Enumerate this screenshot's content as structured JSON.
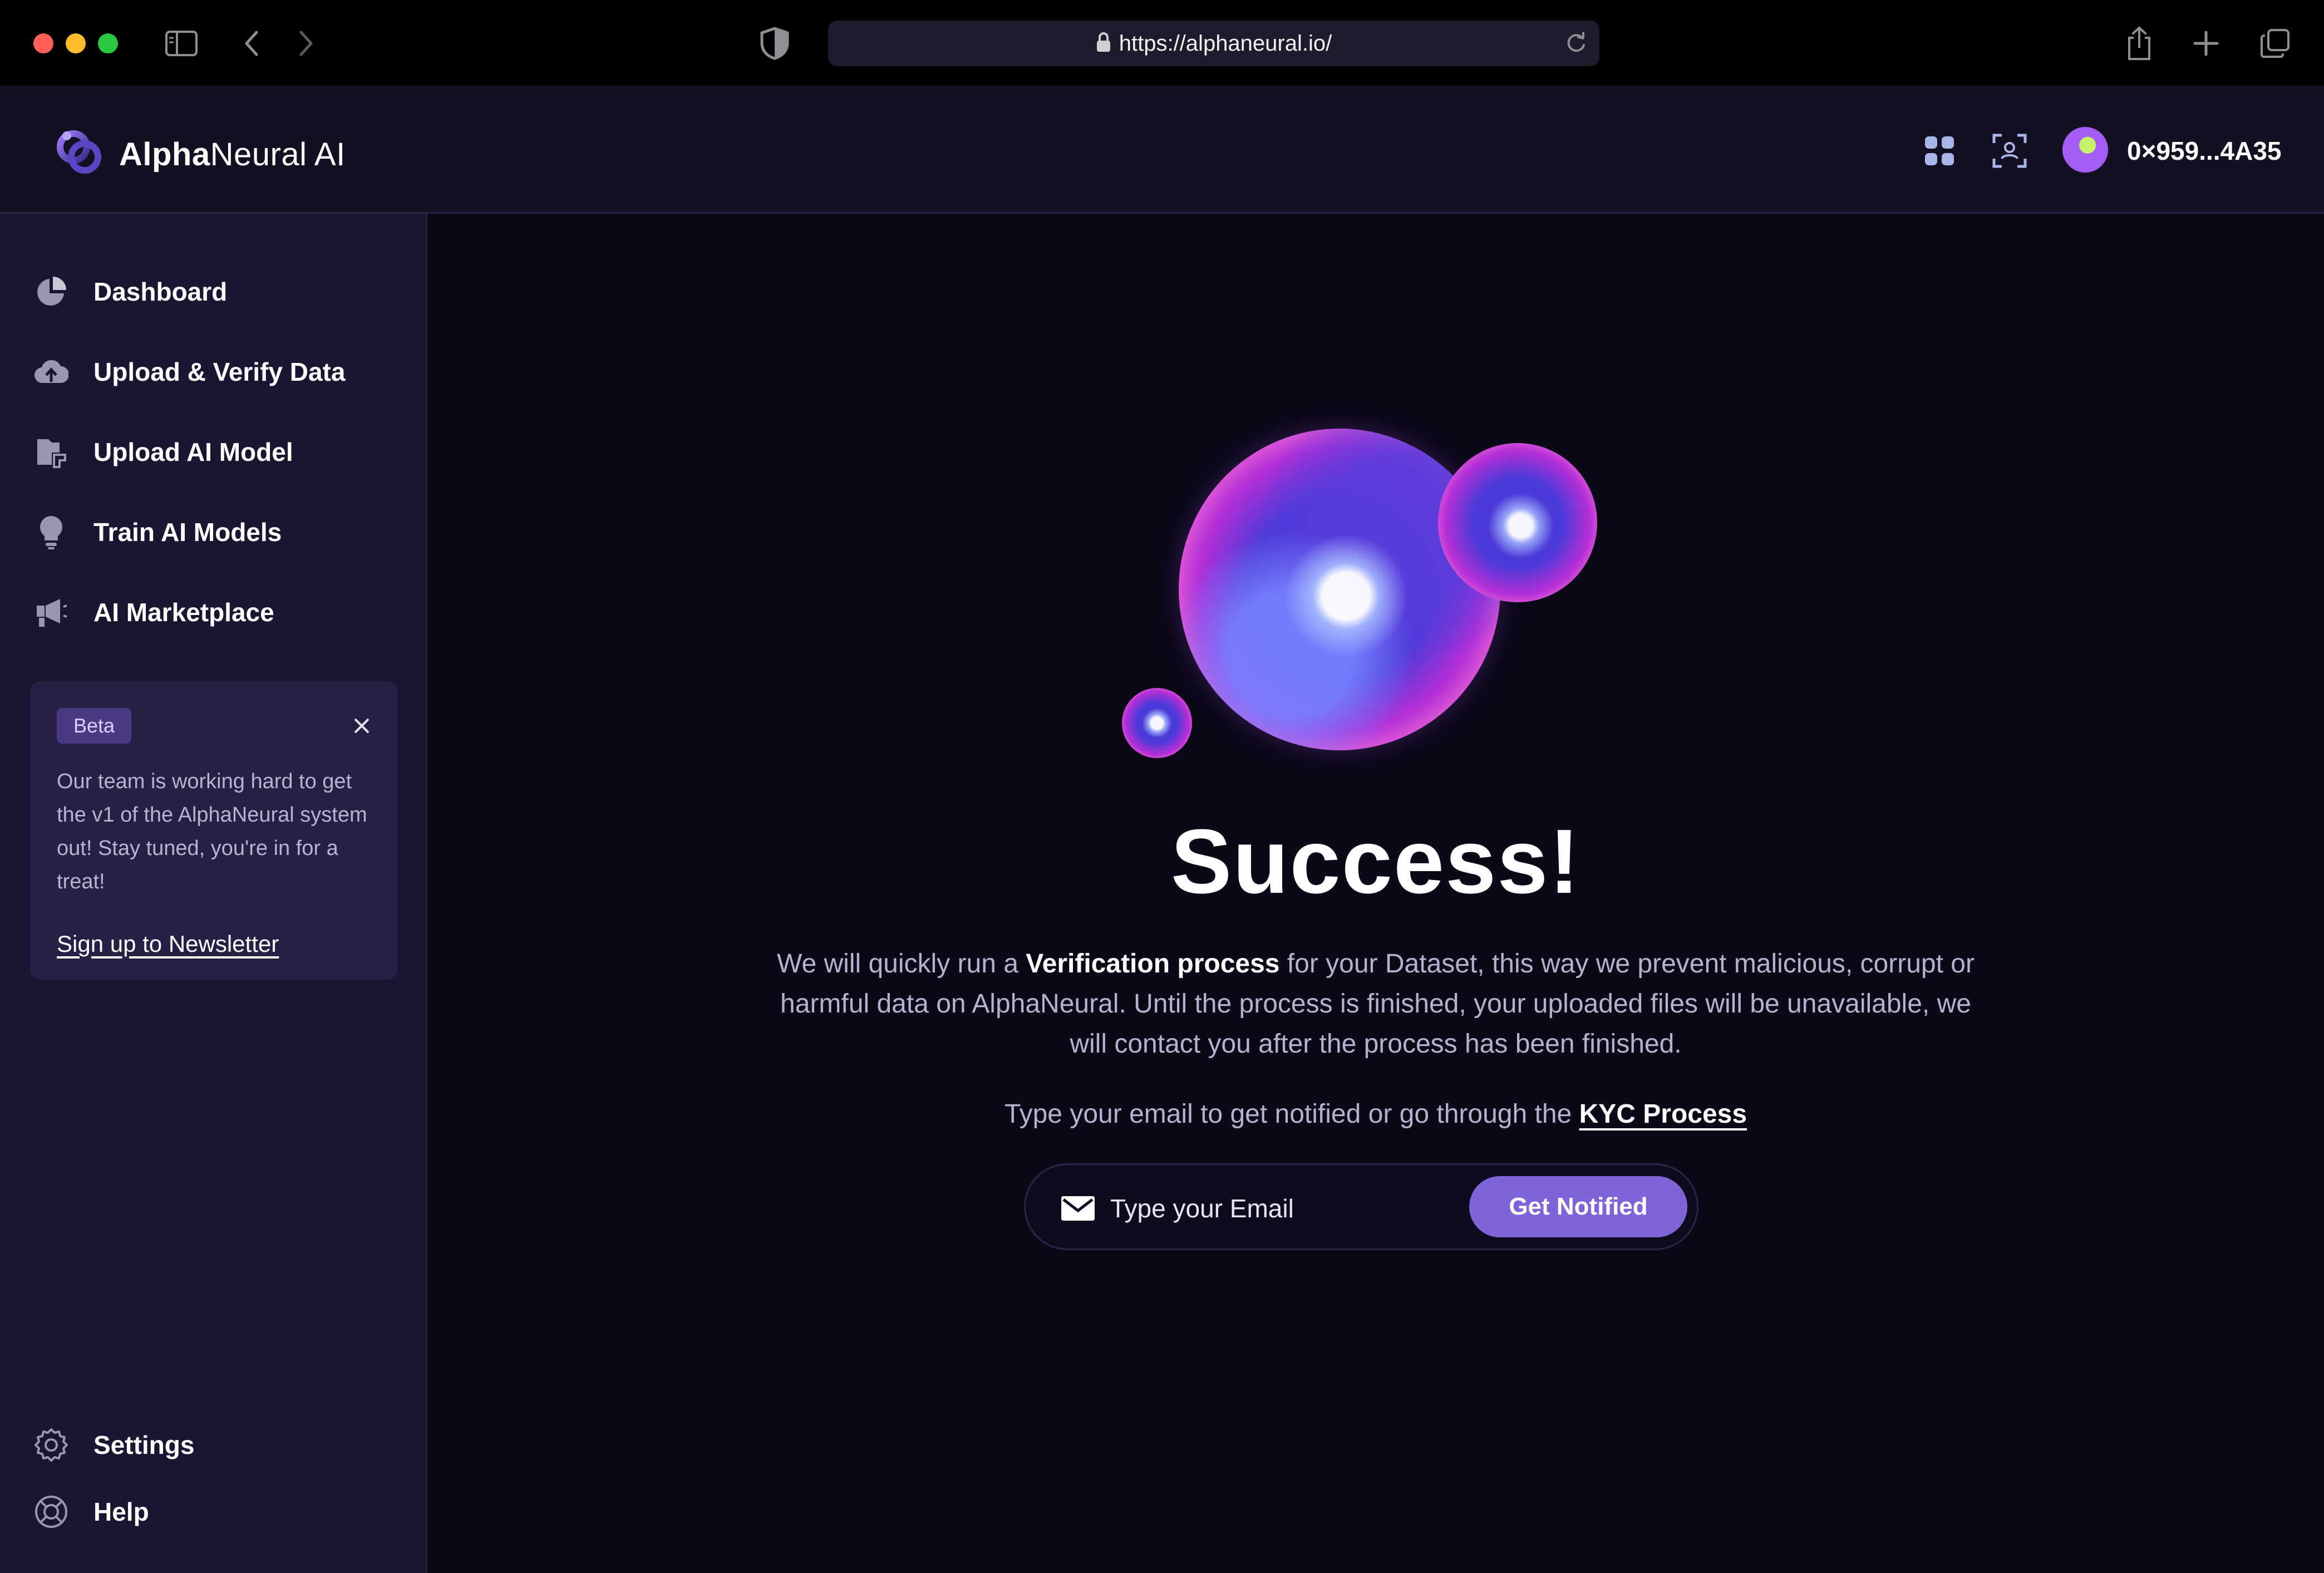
{
  "browser": {
    "url": "https://alphaneural.io/"
  },
  "header": {
    "brand_bold": "Alpha",
    "brand_rest": "Neural AI",
    "wallet_address": "0×959...4A35"
  },
  "sidebar": {
    "items": [
      {
        "label": "Dashboard",
        "icon": "pie-chart-icon"
      },
      {
        "label": "Upload & Verify Data",
        "icon": "cloud-upload-icon"
      },
      {
        "label": "Upload AI Model",
        "icon": "model-upload-icon"
      },
      {
        "label": "Train AI Models",
        "icon": "lightbulb-icon"
      },
      {
        "label": "AI Marketplace",
        "icon": "megaphone-icon"
      }
    ],
    "beta_card": {
      "badge": "Beta",
      "text": "Our team is working hard to get the v1 of the AlphaNeural system out! Stay tuned, you're in for a treat!",
      "link": "Sign up to Newsletter"
    },
    "bottom_items": [
      {
        "label": "Settings",
        "icon": "gear-icon"
      },
      {
        "label": "Help",
        "icon": "lifebuoy-icon"
      }
    ]
  },
  "main": {
    "title": "Success!",
    "desc_before": "We will quickly run a ",
    "desc_bold": "Verification process",
    "desc_after": " for your Dataset, this way we prevent malicious, corrupt or harmful data on AlphaNeural. Until the process is finished, your uploaded files will be unavailable, we will contact you after the  process has been finished.",
    "kyc_prefix": "Type your email to get notified or go through the ",
    "kyc_link": "KYC Process",
    "email_placeholder": "Type your Email",
    "notify_button": "Get Notified"
  },
  "colors": {
    "accent": "#7f63d8",
    "sidebar_bg": "#1a1530",
    "main_bg": "#0b0818"
  }
}
